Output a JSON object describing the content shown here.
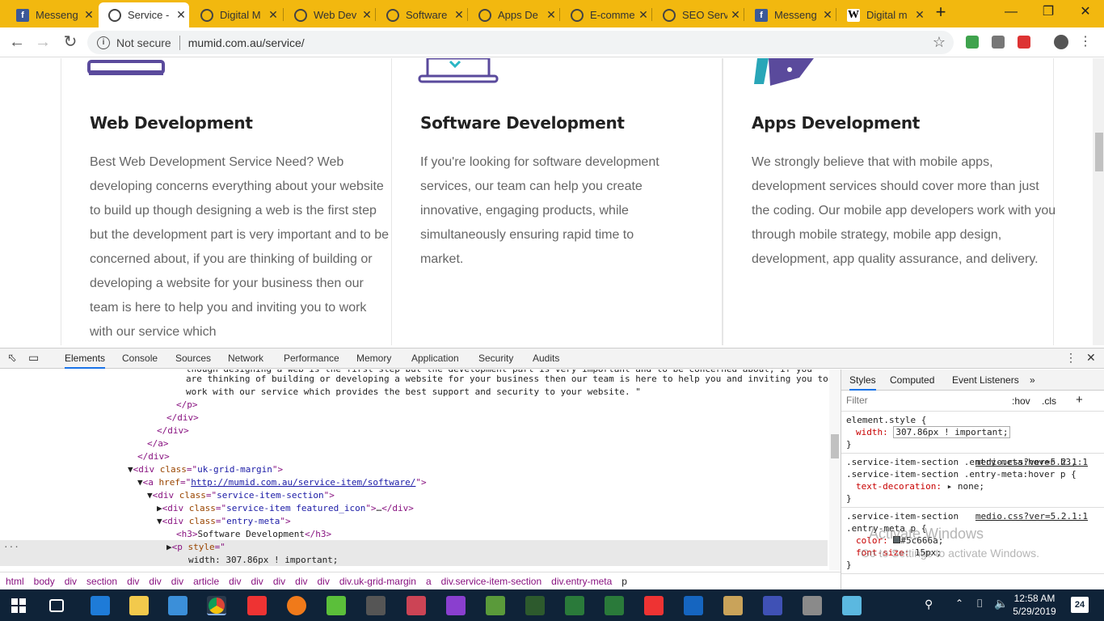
{
  "browser": {
    "tabs": [
      {
        "title": "Messeng",
        "icon": "facebook-icon"
      },
      {
        "title": "Service -",
        "icon": "globe-icon"
      },
      {
        "title": "Digital M",
        "icon": "globe-icon"
      },
      {
        "title": "Web Dev",
        "icon": "globe-icon"
      },
      {
        "title": "Software",
        "icon": "globe-icon"
      },
      {
        "title": "Apps De",
        "icon": "globe-icon"
      },
      {
        "title": "E-comme",
        "icon": "globe-icon"
      },
      {
        "title": "SEO Serv",
        "icon": "globe-icon"
      },
      {
        "title": "Messeng",
        "icon": "facebook-icon"
      },
      {
        "title": "Digital m",
        "icon": "wikipedia-icon"
      }
    ],
    "security_label": "Not secure",
    "url": "mumid.com.au/service/",
    "tab_close": "✕",
    "new_tab": "+"
  },
  "page": {
    "cards": [
      {
        "title": "Web Development",
        "text": "Best Web Development Service Need? Web developing concerns everything about your website to build up though designing a web is the first step but the development part is very important and to be concerned about, if you are thinking of building or developing a website for your business then our team is here to help you and inviting you to work with our service which"
      },
      {
        "title": "Software Development",
        "text": "If you're looking for software development services, our team can help you create innovative, engaging products, while simultaneously ensuring rapid time to market."
      },
      {
        "title": "Apps Development",
        "text": "We strongly believe that with mobile apps, development services should cover more than just the coding. Our mobile app developers work with you through mobile strategy, mobile app design, development, app quality assurance, and delivery."
      }
    ]
  },
  "devtools": {
    "tabs": [
      "Elements",
      "Console",
      "Sources",
      "Network",
      "Performance",
      "Memory",
      "Application",
      "Security",
      "Audits"
    ],
    "code_text_1": "though designing a web is the first step but the development part is very important and to be concerned about, if you",
    "code_text_2": "are thinking of building or developing a website for your business then our team is here to help you and inviting you to",
    "code_text_3": "work with our service which provides the best support and security to your website. \"",
    "href": "http://mumid.com.au/service-item/software/",
    "h3_text": "Software Development",
    "style_decl": "width: 307.86px ! important;",
    "breadcrumbs": [
      "html",
      "body",
      "div",
      "section",
      "div",
      "div",
      "div",
      "article",
      "div",
      "div",
      "div",
      "div",
      "div",
      "div.uk-grid-margin",
      "a",
      "div.service-item-section",
      "div.entry-meta",
      "p"
    ],
    "styles_tabs": [
      "Styles",
      "Computed",
      "Event Listeners"
    ],
    "filter_placeholder": "Filter",
    "hov": ":hov",
    "cls": ".cls",
    "element_style": "element.style {",
    "width_prop": "width:",
    "width_val": "307.86px ! important;",
    "rule2_sel": ".service-item-section .entry-meta:hover h3, .service-item-section .entry-meta:hover p {",
    "rule2_src": "medio.css?ver=5.2.1:1",
    "rule2_prop": "text-decoration:",
    "rule2_val": "▸ none;",
    "rule3_sel": ".service-item-section .entry-meta p {",
    "rule3_src": "medio.css?ver=5.2.1:1",
    "rule3_prop1": "color:",
    "rule3_val1": "#5c666a;",
    "rule3_prop2": "font-size:",
    "rule3_val2": "15px;",
    "watermark_1": "Activate Windows",
    "watermark_2": "Go to Settings to activate Windows."
  },
  "taskbar": {
    "time": "12:58 AM",
    "date": "5/29/2019",
    "notifications": "24"
  }
}
